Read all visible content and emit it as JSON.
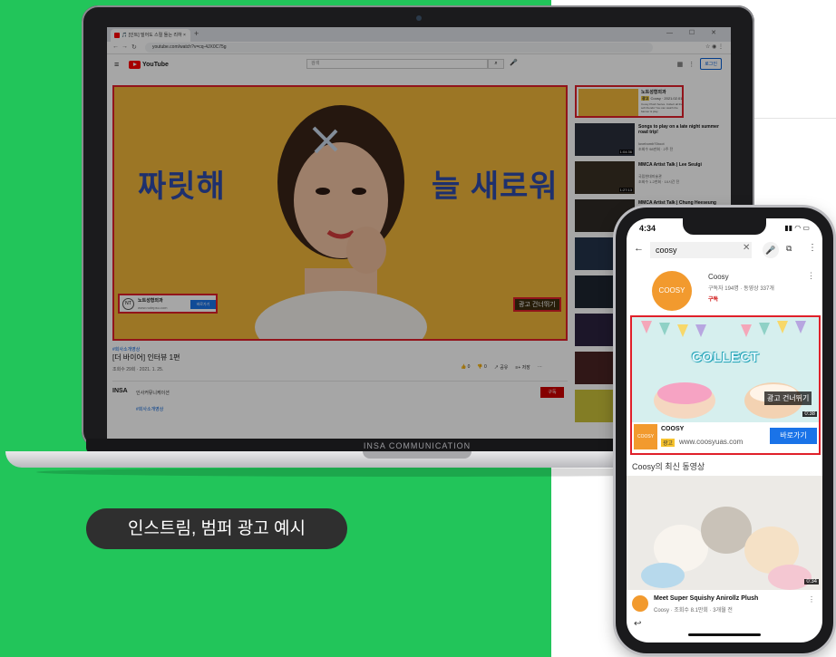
{
  "caption": "인스트림, 범퍼 광고 예시",
  "laptop": {
    "brand": "INSA COMMUNICATION",
    "browser": {
      "tab_title": "🎵 [인트] 밀어도 스릴 돌는 리하 ×",
      "url": "youtube.com/watch?v=cq-4JX0C75g",
      "window_controls": "—  ☐  ✕"
    },
    "youtube": {
      "logo": "YouTube",
      "search_placeholder": "검색",
      "login": "로그인"
    },
    "player": {
      "ad_text_left": "짜릿해",
      "ad_text_right": "늘 새로워",
      "card_logo": "NT",
      "card_name": "노트성형외과",
      "card_url": "www.notepsu.com",
      "card_button": "바로가기",
      "skip": "광고 건너뛰기"
    },
    "video": {
      "hashtag": "#회사소개영상",
      "title": "[더 바이어] 인터뷰 1편",
      "meta": "조회수 29회 · 2021. 1. 25.",
      "actions": [
        "👍 0",
        "👎 0",
        "↗ 공유",
        "≡+ 저장",
        "···"
      ],
      "channel_logo": "INSA",
      "channel_name": "인사커뮤니케이션",
      "subscribe": "구독",
      "hashtag2": "#회사소개영상"
    },
    "sidebar": {
      "ad": {
        "title": "노트성형외과",
        "badge": "광고",
        "badge_text": "Coosy · 2021.02.01",
        "desc": "Coosy Plush Series. Collect all the soft friends! You can watch the banner & play."
      },
      "items": [
        {
          "title": "Songs to play on a late night summer road trip!",
          "channel": "lovebomb'Shoot",
          "views": "조회수 98만회 · 2주 전",
          "duration": "1:04:36"
        },
        {
          "title": "MMCA Artist Talk | Lee Seulgi",
          "channel": "국립현대미술관",
          "views": "조회수 1.2천회 · 10시간 전",
          "duration": "1:27:13"
        },
        {
          "title": "MMCA Artist Talk | Chung Heeseung",
          "channel": "국립현대미술관",
          "views": "",
          "duration": ""
        }
      ]
    }
  },
  "phone": {
    "time": "4:34",
    "status_icons": "▮▮ ◠ ▭",
    "search_query": "coosy",
    "channel": {
      "avatar_text": "COOSY",
      "name": "Coosy",
      "stats": "구독자 194명 · 동영상 337개",
      "subscribe": "구독"
    },
    "ad": {
      "headline": "COLLECT",
      "skip": "광고 건너뛰기",
      "duration": "0:38",
      "logo": "COOSY",
      "name": "COOSY",
      "badge": "광고",
      "url": "www.coosyuas.com",
      "button": "바로가기"
    },
    "section_title": "Coosy의 최신 동영상",
    "video": {
      "duration": "0:34",
      "title": "Meet Super Squishy Anirollz Plush",
      "meta": "Coosy · 조회수 8.1만회 · 3개월 전"
    }
  }
}
